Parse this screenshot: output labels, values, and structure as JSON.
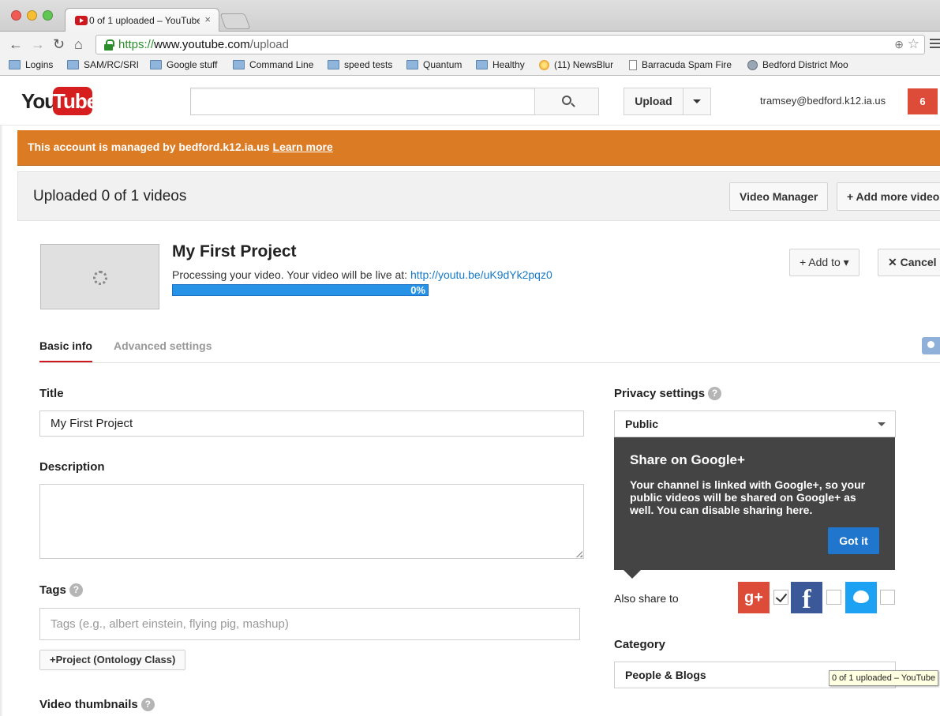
{
  "browser": {
    "tab_title": "0 of 1 uploaded – YouTube",
    "tab_close": "×",
    "url_scheme": "https://",
    "url_host": "www.youtube.com",
    "url_path": "/upload",
    "back": "←",
    "forward": "→",
    "reload": "↻",
    "home": "⌂",
    "star": "☆",
    "zoom": "⊕",
    "bookmarks": [
      {
        "label": "Logins",
        "icon": "folder"
      },
      {
        "label": "SAM/RC/SRI",
        "icon": "folder"
      },
      {
        "label": "Google stuff",
        "icon": "folder"
      },
      {
        "label": "Command Line",
        "icon": "folder"
      },
      {
        "label": "speed tests",
        "icon": "folder"
      },
      {
        "label": "Quantum",
        "icon": "folder"
      },
      {
        "label": "Healthy",
        "icon": "folder"
      },
      {
        "label": "(11) NewsBlur",
        "icon": "newsblur"
      },
      {
        "label": "Barracuda Spam Fire",
        "icon": "page"
      },
      {
        "label": "Bedford District Moo",
        "icon": "globe"
      }
    ]
  },
  "header": {
    "logo_you": "You",
    "logo_tube": "Tube",
    "search_value": "",
    "upload_label": "Upload",
    "account": "tramsey@bedford.k12.ia.us",
    "notifications": "6"
  },
  "banner": {
    "text": "This account is managed by bedford.k12.ia.us",
    "link": "Learn more"
  },
  "upload": {
    "heading": "Uploaded 0 of 1 videos",
    "video_manager": "Video Manager",
    "add_more": "Add more videos",
    "video_title": "My First Project",
    "processing_text": "Processing your video. Your video will be live at:",
    "video_link": "http://youtu.be/uK9dYk2pqz0",
    "progress_label": "0%",
    "progress_percent": 0,
    "add_to": "Add to",
    "cancel": "Cancel"
  },
  "tabs": {
    "basic": "Basic info",
    "advanced": "Advanced settings"
  },
  "form": {
    "title_label": "Title",
    "title_value": "My First Project",
    "description_label": "Description",
    "description_value": "",
    "tags_label": "Tags",
    "tags_placeholder": "Tags (e.g., albert einstein, flying pig, mashup)",
    "suggested_tag": "+Project (Ontology Class)",
    "thumbnails_label": "Video thumbnails",
    "help_glyph": "?"
  },
  "privacy": {
    "label": "Privacy settings",
    "selected": "Public",
    "card_title": "Share on Google+",
    "card_body": "Your channel is linked with Google+, so your public videos will be shared on Google+ as well. You can disable sharing here.",
    "got_it": "Got it",
    "also_share": "Also share to",
    "gplus_glyph": "g+",
    "facebook_glyph": "f",
    "category_label": "Category",
    "category_selected": "People & Blogs"
  },
  "tooltip": "0 of 1 uploaded – YouTube"
}
